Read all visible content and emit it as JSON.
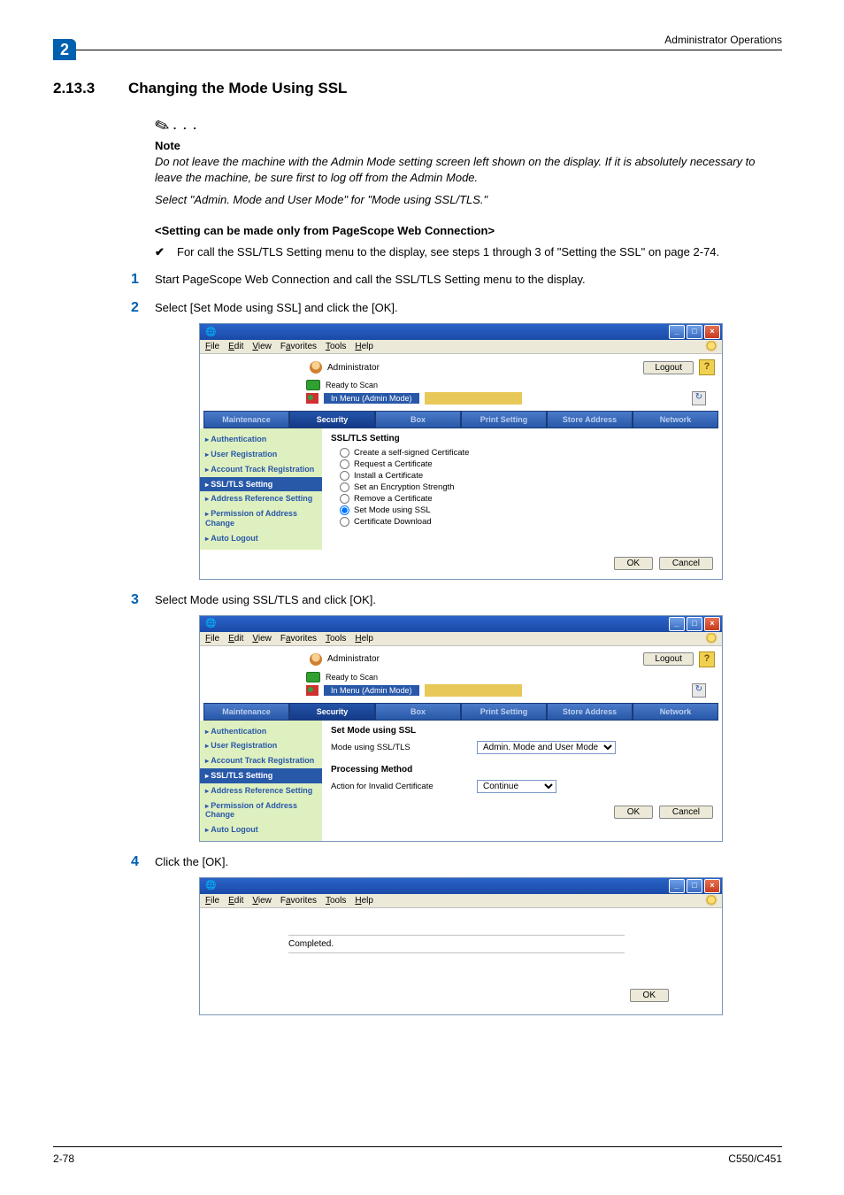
{
  "header": {
    "chapter_num": "2",
    "right_label": "Administrator Operations"
  },
  "section": {
    "number": "2.13.3",
    "title": "Changing the Mode Using SSL"
  },
  "note": {
    "label": "Note",
    "p1": "Do not leave the machine with the Admin Mode setting screen left shown on the display. If it is absolutely necessary to leave the machine, be sure first to log off from the Admin Mode.",
    "p2": "Select \"Admin. Mode and User Mode\" for \"Mode using SSL/TLS.\""
  },
  "subheading": "<Setting can be made only from PageScope Web Connection>",
  "bullet": "For call the SSL/TLS Setting menu to the display, see steps 1 through 3 of \"Setting the SSL\" on page 2-74.",
  "steps": {
    "s1": "Start PageScope Web Connection and call the SSL/TLS Setting menu to the display.",
    "s2": "Select [Set Mode using SSL] and click the [OK].",
    "s3": "Select Mode using SSL/TLS and click [OK].",
    "s4": "Click the [OK]."
  },
  "browserMenu": {
    "file": "File",
    "edit": "Edit",
    "view": "View",
    "favorites": "Favorites",
    "tools": "Tools",
    "help": "Help"
  },
  "adminArea": {
    "role": "Administrator",
    "logout": "Logout",
    "ready": "Ready to Scan",
    "mode": "In Menu (Admin Mode)"
  },
  "tabs": {
    "maintenance": "Maintenance",
    "security": "Security",
    "box": "Box",
    "print": "Print Setting",
    "store": "Store Address",
    "network": "Network"
  },
  "sidebar": {
    "auth": "Authentication",
    "userReg": "User Registration",
    "acctTrack": "Account Track Registration",
    "ssl": "SSL/TLS Setting",
    "addrRef": "Address Reference Setting",
    "permAddr": "Permission of Address Change",
    "autoLogout": "Auto Logout"
  },
  "panel1": {
    "title": "SSL/TLS Setting",
    "o1": "Create a self-signed Certificate",
    "o2": "Request a Certificate",
    "o3": "Install a Certificate",
    "o4": "Set an Encryption Strength",
    "o5": "Remove a Certificate",
    "o6": "Set Mode using SSL",
    "o7": "Certificate Download"
  },
  "panel2": {
    "title1": "Set Mode using SSL",
    "row1label": "Mode using SSL/TLS",
    "row1value": "Admin. Mode and User Mode",
    "title2": "Processing Method",
    "row2label": "Action for Invalid Certificate",
    "row2value": "Continue"
  },
  "buttons": {
    "ok": "OK",
    "cancel": "Cancel"
  },
  "panel3": {
    "completed": "Completed."
  },
  "footer": {
    "left": "2-78",
    "right": "C550/C451"
  }
}
